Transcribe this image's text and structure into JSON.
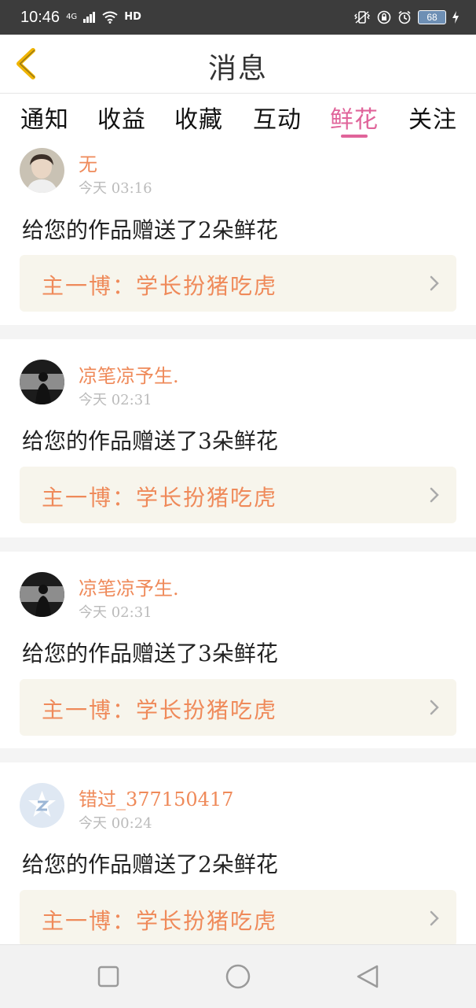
{
  "status_bar": {
    "time": "10:46",
    "network_label": "4G",
    "hd_label": "HD",
    "battery": "68"
  },
  "header": {
    "title": "消息",
    "back_icon": "chevron-left-icon"
  },
  "tabs": [
    {
      "label": "通知",
      "active": false
    },
    {
      "label": "收益",
      "active": false
    },
    {
      "label": "收藏",
      "active": false
    },
    {
      "label": "互动",
      "active": false
    },
    {
      "label": "鲜花",
      "active": true
    },
    {
      "label": "关注",
      "active": false
    }
  ],
  "messages": [
    {
      "user": "无",
      "time": "今天 03:16",
      "text": "给您的作品赠送了2朵鲜花",
      "work": "主一博：学长扮猪吃虎"
    },
    {
      "user": "凉笔凉予生.",
      "time": "今天 02:31",
      "text": "给您的作品赠送了3朵鲜花",
      "work": "主一博：学长扮猪吃虎"
    },
    {
      "user": "凉笔凉予生.",
      "time": "今天 02:31",
      "text": "给您的作品赠送了3朵鲜花",
      "work": "主一博：学长扮猪吃虎"
    },
    {
      "user": "错过_377150417",
      "time": "今天 00:24",
      "text": "给您的作品赠送了2朵鲜花",
      "work": "主一博：学长扮猪吃虎"
    }
  ],
  "colors": {
    "accent_pink": "#e0649a",
    "accent_orange": "#ef8a5a",
    "card_ref_bg": "#f7f5ec",
    "back_icon": "#f0b400"
  }
}
